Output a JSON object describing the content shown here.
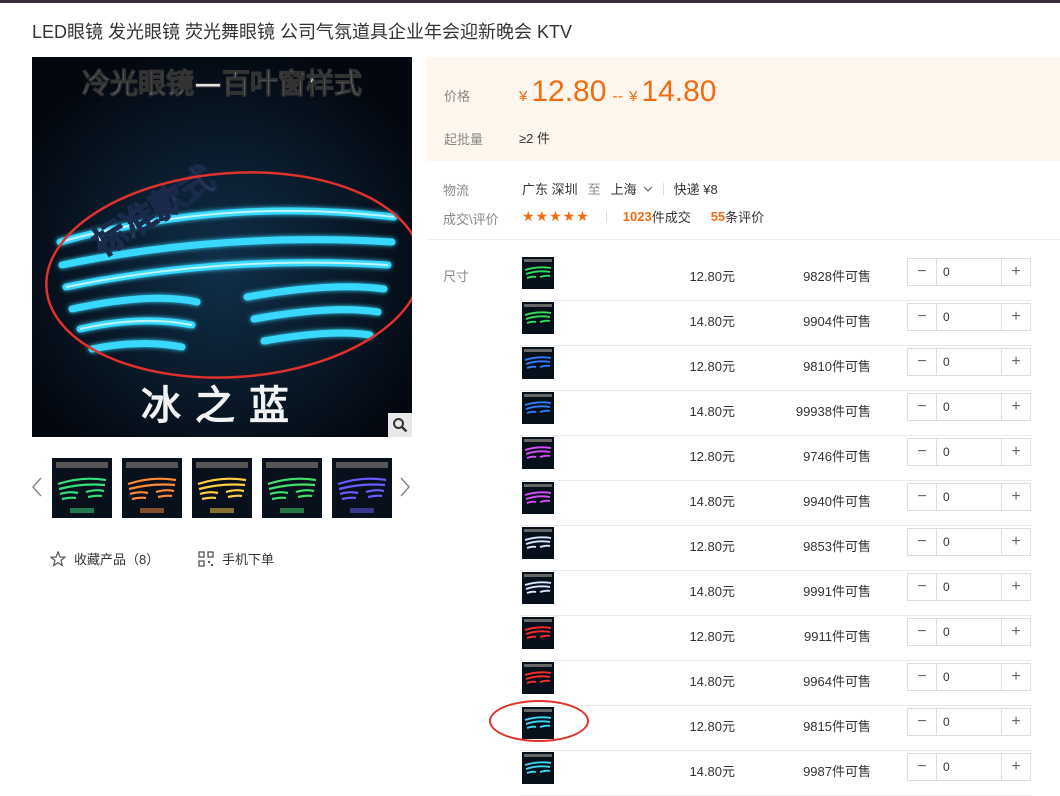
{
  "product": {
    "title": "LED眼镜 发光眼镜 荧光舞眼镜 公司气氛道具企业年会迎新晚会 KTV"
  },
  "main_image": {
    "banner_text": "冷光眼镜—百叶窗样式",
    "badge_text": "标准款式",
    "caption": "冰之蓝",
    "icon": "magnifier-icon"
  },
  "gallery": {
    "thumbnails": [
      {
        "color": "#33e07a"
      },
      {
        "color": "#ff8a3a"
      },
      {
        "color": "#ffd040"
      },
      {
        "color": "#40e06a"
      },
      {
        "color": "#6a5cff"
      }
    ],
    "prev_icon": "chevron-left-icon",
    "next_icon": "chevron-right-icon"
  },
  "actions": {
    "favorite_label": "收藏产品（8）",
    "favorite_icon": "star-outline-icon",
    "mobile_label": "手机下单",
    "mobile_icon": "qr-code-icon"
  },
  "pricing": {
    "label": "价格",
    "currency": "¥",
    "low": "12.80",
    "dash": "--",
    "high": "14.80",
    "moq_label": "起批量",
    "moq_value": "≥2 件"
  },
  "logistics": {
    "label": "物流",
    "origin": "广东 深圳",
    "to": "至",
    "dest": "上海",
    "express": "快递 ¥8"
  },
  "deals": {
    "label": "成交\\评价",
    "stars": "★★★★★",
    "deal_count": "1023",
    "deal_suffix": "件成交",
    "review_count": "55",
    "review_suffix": "条评价"
  },
  "sku": {
    "label": "尺寸",
    "rows": [
      {
        "price": "12.80元",
        "stock": "9828件可售",
        "qty": "0",
        "color": "#2ee05a"
      },
      {
        "price": "14.80元",
        "stock": "9904件可售",
        "qty": "0",
        "color": "#2ee05a"
      },
      {
        "price": "12.80元",
        "stock": "9810件可售",
        "qty": "0",
        "color": "#2e7cff"
      },
      {
        "price": "14.80元",
        "stock": "99938件可售",
        "qty": "0",
        "color": "#2e7cff"
      },
      {
        "price": "12.80元",
        "stock": "9746件可售",
        "qty": "0",
        "color": "#d84cff"
      },
      {
        "price": "14.80元",
        "stock": "9940件可售",
        "qty": "0",
        "color": "#d84cff"
      },
      {
        "price": "12.80元",
        "stock": "9853件可售",
        "qty": "0",
        "color": "#d8e8ff"
      },
      {
        "price": "14.80元",
        "stock": "9991件可售",
        "qty": "0",
        "color": "#d8e8ff"
      },
      {
        "price": "12.80元",
        "stock": "9911件可售",
        "qty": "0",
        "color": "#ff2b2b"
      },
      {
        "price": "14.80元",
        "stock": "9964件可售",
        "qty": "0",
        "color": "#ff2b2b"
      },
      {
        "price": "12.80元",
        "stock": "9815件可售",
        "qty": "0",
        "color": "#3ad8f2"
      },
      {
        "price": "14.80元",
        "stock": "9987件可售",
        "qty": "0",
        "color": "#3ad8f2"
      }
    ],
    "minus": "−",
    "plus": "+"
  },
  "colors": {
    "accent": "#f26b0f",
    "price_bg": "#fff6ee",
    "annotation": "#e0322c"
  }
}
